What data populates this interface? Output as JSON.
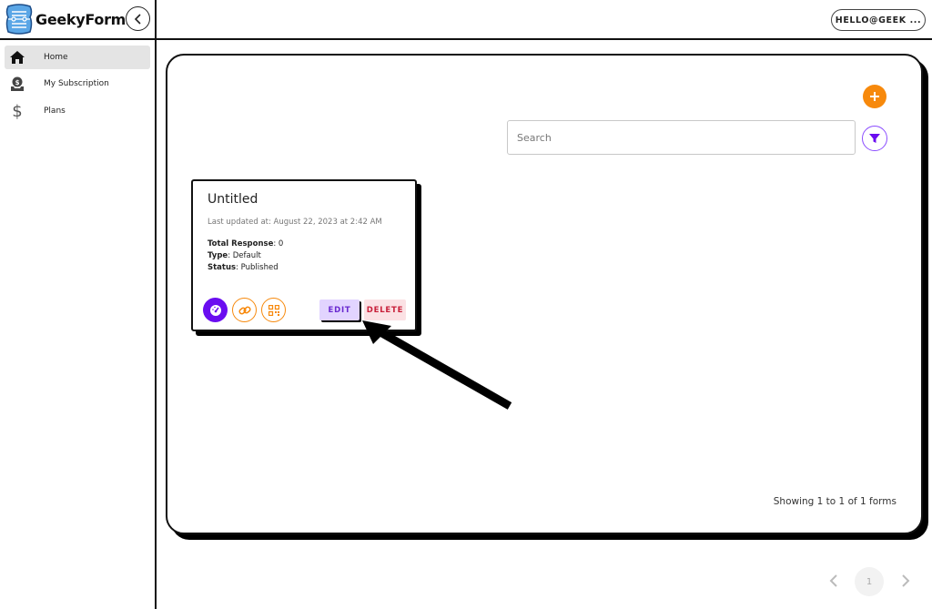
{
  "app": {
    "name": "GeekyForms",
    "user_label": "HELLO@GEEK ..."
  },
  "sidebar": {
    "items": [
      {
        "label": "Home",
        "icon": "home-icon",
        "active": true
      },
      {
        "label": "My Subscription",
        "icon": "subscription-icon",
        "active": false
      },
      {
        "label": "Plans",
        "icon": "dollar-icon",
        "active": false
      }
    ]
  },
  "toolbar": {
    "search_placeholder": "Search",
    "search_value": "",
    "add_label": "+"
  },
  "forms": [
    {
      "title": "Untitled",
      "last_updated": "Last updated at: August 22, 2023 at 2:42 AM",
      "total_response_label": "Total Response",
      "total_response_value": ": 0",
      "type_label": "Type",
      "type_value": ": Default",
      "status_label": "Status",
      "status_value": ": Published",
      "edit_label": "EDIT",
      "delete_label": "DELETE"
    }
  ],
  "footer": {
    "showing_text": "Showing 1 to 1 of 1 forms"
  },
  "pagination": {
    "current_page": "1"
  },
  "colors": {
    "accent_orange": "#f7890c",
    "accent_purple": "#6a0df0",
    "edit_bg": "#e2d4ff",
    "delete_bg": "#fbe1e4"
  }
}
